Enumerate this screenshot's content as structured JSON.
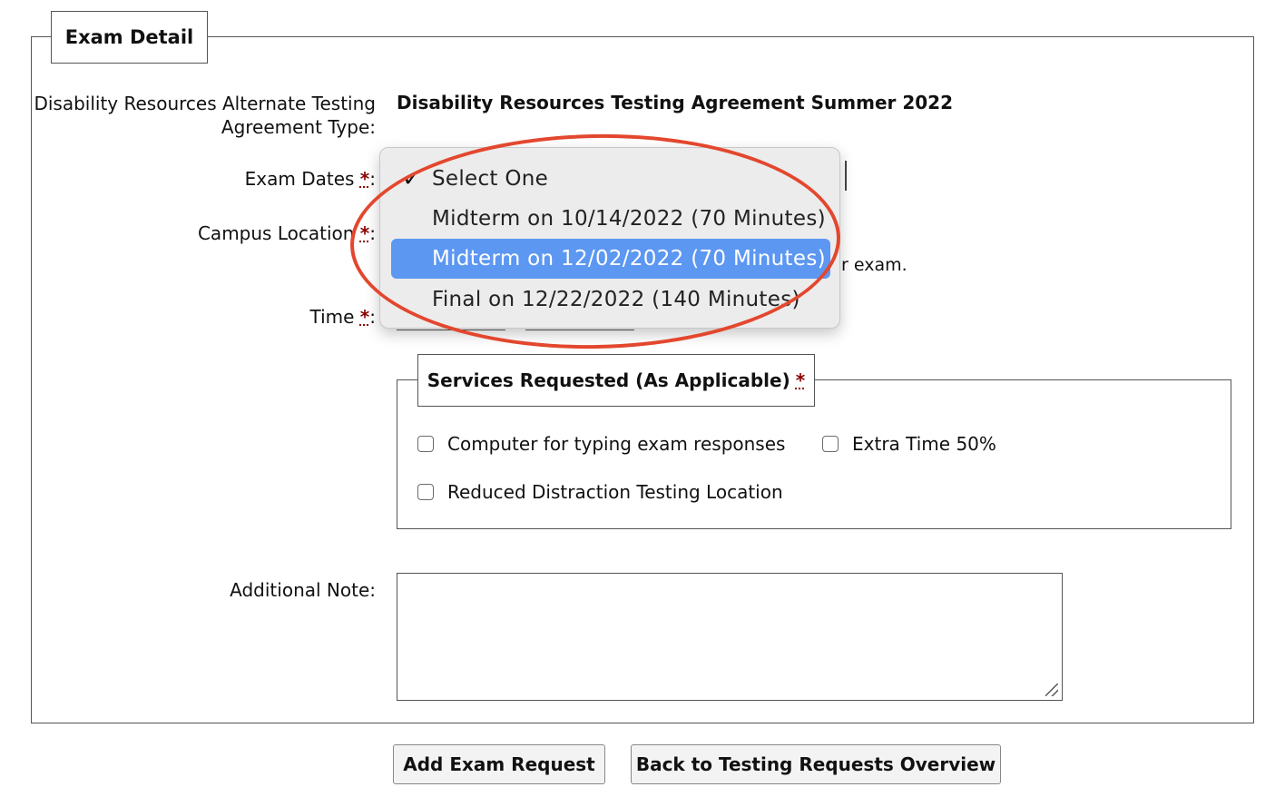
{
  "fieldset": {
    "legend": "Exam Detail"
  },
  "agreement": {
    "label_line1": "Disability Resources Alternate Testing",
    "label_line2": "Agreement Type:",
    "value": "Disability Resources Testing Agreement Summer 2022"
  },
  "exam_dates": {
    "label": "Exam Dates ",
    "required_mark": "*",
    "options": [
      "Select One",
      "Midterm on 10/14/2022 (70 Minutes)",
      "Midterm on 12/02/2022 (70 Minutes)",
      "Final on 12/22/2022 (140 Minutes)"
    ],
    "checked_option": "Select One",
    "highlighted_option": "Midterm on 12/02/2022 (70 Minutes)"
  },
  "campus_location": {
    "label": "Campus Location ",
    "required_mark": "*",
    "partial_hint": "ur exam."
  },
  "time": {
    "label": "Time ",
    "required_mark": "*"
  },
  "services": {
    "legend": "Services Requested (As Applicable) ",
    "required_mark": "*",
    "options": [
      "Computer for typing exam responses",
      "Extra Time 50%",
      "Reduced Distraction Testing Location"
    ]
  },
  "additional_note": {
    "label": "Additional Note:",
    "value": ""
  },
  "buttons": {
    "add": "Add Exam Request",
    "back": "Back to Testing Requests Overview"
  },
  "colors": {
    "highlight": "#5c97f2",
    "annotation_ring": "#e3472e",
    "required": "#8b0000"
  }
}
